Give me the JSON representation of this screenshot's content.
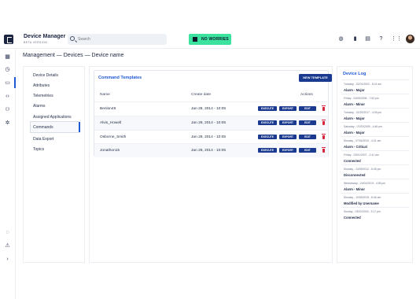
{
  "header": {
    "app_title": "Device Manager",
    "app_subtitle": "BETA VERSION",
    "search_placeholder": "Search",
    "status_label": "NO WORRIES",
    "icons": [
      "globe-icon",
      "bar-chart-icon",
      "chat-icon",
      "help-icon",
      "apps-grid-icon"
    ]
  },
  "sidenav": {
    "icons": [
      "dashboard-icon",
      "clock-icon",
      "devices-icon",
      "code-icon",
      "users-icon",
      "settings-icon"
    ],
    "bottom_icons": [
      "loading-icon",
      "warning-icon",
      "expand-icon"
    ]
  },
  "breadcrumb": "Management — Devices — Device name",
  "subnav": {
    "items": [
      "Device Details",
      "Attributes",
      "Telemetries",
      "Alarms",
      "Assigned Applications",
      "Commands",
      "Data Export",
      "Topics"
    ],
    "active": "Commands"
  },
  "templates": {
    "title": "Command Templates",
    "new_button": "NEW TEMPLATE",
    "columns": {
      "name": "Name",
      "date": "Create date",
      "actions": "Actions"
    },
    "actions": {
      "execute": "EXECUTE",
      "export": "EXPORT",
      "edit": "EDIT"
    },
    "rows": [
      {
        "name": "Benlon46",
        "date": "Jan 28, 2014 - 10:05"
      },
      {
        "name": "Alvis_Howell",
        "date": "Jan 28, 2014 - 10:05"
      },
      {
        "name": "Osborne_Smith",
        "date": "Jan 28, 2014 - 10:05"
      },
      {
        "name": "Jonathon15",
        "date": "Jan 28, 2014 - 10:05"
      }
    ]
  },
  "log": {
    "title": "Device Log",
    "entries": [
      {
        "date": "Tuesday - 02/01/2002 - 8:41 am",
        "event": "Alarm - Major"
      },
      {
        "date": "Friday - 04/05/2006 - 7:53 pm",
        "event": "Alarm - Minor"
      },
      {
        "date": "Tuesday - 02/20/2017 - 4:26 pm",
        "event": "Alarm - Major"
      },
      {
        "date": "Saturday - 07/03/2009 - 4:46 pm",
        "event": "Alarm - Major"
      },
      {
        "date": "Monday - 07/04/2010 - 4:21 am",
        "event": "Alarm - Critical"
      },
      {
        "date": "Friday - 23/01/2007 - 2:41 am",
        "event": "Connected"
      },
      {
        "date": "Monday - 24/09/2012 - 6:45 pm",
        "event": "Disconnected"
      },
      {
        "date": "Wednesday - 24/01/2019 - 4:38 pm",
        "event": "Alarm - Minor"
      },
      {
        "date": "Monday - 10/09/2015 - 8:46 am",
        "event": "Modified by Username"
      },
      {
        "date": "Sunday - 03/02/2003 - 3:17 pm",
        "event": "Connected"
      }
    ]
  }
}
